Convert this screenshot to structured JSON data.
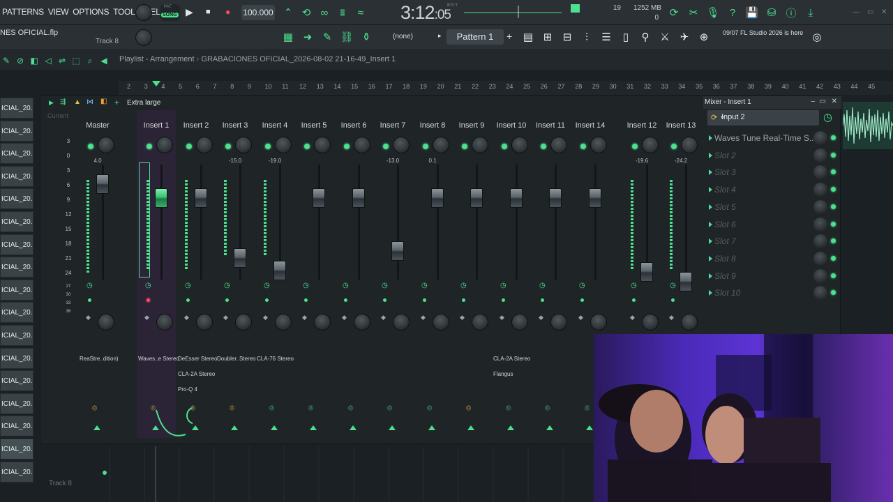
{
  "menu": [
    "PATTERNS",
    "VIEW",
    "OPTIONS",
    "TOOLS",
    "HELP"
  ],
  "transport": {
    "mode_top": "PAT",
    "mode_bottom": "SONG",
    "tempo": "100.000",
    "time_main": "3:12",
    "time_sub": "05",
    "time_label": "B:S:T"
  },
  "perf": {
    "cpu": "19",
    "memory": "1252 MB",
    "poly": "0"
  },
  "project": {
    "file": "NES OFICIAL.flp",
    "track": "Track 8"
  },
  "pattern": {
    "name": "Pattern 1",
    "channel": "(none)"
  },
  "hint": {
    "date": "09/07",
    "text": "FL Studio 2026 is here"
  },
  "playlist": {
    "crumb1": "Playlist - Arrangement",
    "crumb2": "GRABACIONES OFICIAL_2026-08-02 21-16-49_Insert 1",
    "ruler": [
      "2",
      "3",
      "4",
      "5",
      "6",
      "7",
      "8",
      "9",
      "10",
      "11",
      "12",
      "13",
      "14",
      "15",
      "16",
      "17",
      "18",
      "19",
      "20",
      "21",
      "22",
      "23",
      "24",
      "25",
      "26",
      "27",
      "28",
      "29",
      "30",
      "31",
      "32",
      "33",
      "34",
      "35",
      "36",
      "37",
      "38",
      "39",
      "40",
      "41",
      "42",
      "43",
      "44",
      "45"
    ],
    "tracks": [
      "ICIAL_20..",
      "ICIAL_20..",
      "ICIAL_20..",
      "ICIAL_20..",
      "ICIAL_20..",
      "ICIAL_20..",
      "ICIAL_20..",
      "ICIAL_20..",
      "ICIAL_20..",
      "ICIAL_20..",
      "ICIAL_20..",
      "ICIAL_20..",
      "ICIAL_20..",
      "ICIAL_20..",
      "ICIAL_20..",
      "ICIAL_20..",
      "ICIAL_20.."
    ],
    "bottom_track": "Track 8"
  },
  "mixer": {
    "size_label": "Extra large",
    "title": "Mixer - Insert 1",
    "current_label": "Current",
    "scale": [
      "3",
      "0",
      "3",
      "6",
      "9",
      "12",
      "15",
      "18",
      "21",
      "24",
      "27",
      "30",
      "33",
      "36"
    ],
    "strips": [
      {
        "name": "Master",
        "db": "4.0",
        "fx": [
          "ReaStre..dition)"
        ]
      },
      {
        "name": "Insert 1",
        "db": "",
        "fx": [
          "Waves..e Stereo"
        ]
      },
      {
        "name": "Insert 2",
        "db": "",
        "fx": [
          "DeEsser Stereo",
          "CLA-2A Stereo",
          "Pro-Q 4"
        ]
      },
      {
        "name": "Insert 3",
        "db": "-15.0",
        "fx": [
          "Doubler..Stereo"
        ]
      },
      {
        "name": "Insert 4",
        "db": "-19.0",
        "fx": [
          "CLA-76 Stereo"
        ]
      },
      {
        "name": "Insert 5",
        "db": "",
        "fx": []
      },
      {
        "name": "Insert 6",
        "db": "",
        "fx": []
      },
      {
        "name": "Insert 7",
        "db": "-13.0",
        "fx": []
      },
      {
        "name": "Insert 8",
        "db": "0.1",
        "fx": []
      },
      {
        "name": "Insert 9",
        "db": "",
        "fx": []
      },
      {
        "name": "Insert 10",
        "db": "",
        "fx": [
          "CLA-2A Stereo",
          "Flangus"
        ]
      },
      {
        "name": "Insert 11",
        "db": "",
        "fx": []
      },
      {
        "name": "Insert 14",
        "db": "",
        "fx": []
      },
      {
        "name": "Insert 12",
        "db": "-19.6",
        "fx": []
      },
      {
        "name": "Insert 13",
        "db": "-24.2",
        "fx": []
      }
    ],
    "input": "Input 2",
    "slots": [
      "Waves Tune Real-Time S..",
      "Slot 2",
      "Slot 3",
      "Slot 4",
      "Slot 5",
      "Slot 6",
      "Slot 7",
      "Slot 8",
      "Slot 9",
      "Slot 10"
    ]
  },
  "colors": {
    "accent": "#4ce08f",
    "background": "#1b2024",
    "panel": "#2a3034"
  }
}
